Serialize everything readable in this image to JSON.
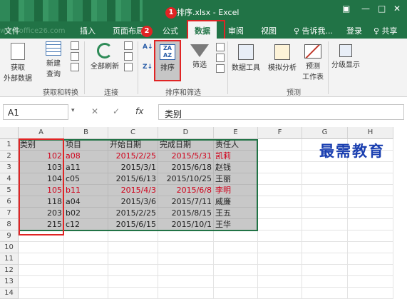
{
  "window": {
    "title": "排序.xlsx - Excel",
    "restore_icon": "ribbon-display-icon",
    "minimize": "—",
    "maximize": "□",
    "close": "✕"
  },
  "watermark_url": "www.office26.com",
  "tabs": [
    {
      "label": "文件"
    },
    {
      "label": "插入"
    },
    {
      "label": "页面布局"
    },
    {
      "label": "公式"
    },
    {
      "label": "数据",
      "active": true
    },
    {
      "label": "审阅"
    },
    {
      "label": "视图"
    },
    {
      "label": "♀ 告诉我..."
    },
    {
      "label": "登录"
    },
    {
      "label": "♀ 共享"
    }
  ],
  "badges": {
    "one": "1",
    "two": "2"
  },
  "ribbon": {
    "get_data": "获取\n外部数据",
    "new_query": "新建\n查询",
    "refresh_all": "全部刷新",
    "sort": "排序",
    "filter": "筛选",
    "data_tools": "数据工具",
    "what_if": "模拟分析",
    "forecast_sheet": "预测\n工作表",
    "outline": "分级显示",
    "groups": {
      "get_transform": "获取和转换",
      "connections": "连接",
      "sort_filter": "排序和筛选",
      "forecast": "预测"
    }
  },
  "formula_bar": {
    "name_box": "A1",
    "cancel": "✕",
    "enter": "✓",
    "fx": "fx",
    "content": "类别"
  },
  "columns": [
    "A",
    "B",
    "C",
    "D",
    "E",
    "F",
    "G",
    "H"
  ],
  "rows": [
    "1",
    "2",
    "3",
    "4",
    "5",
    "6",
    "7",
    "8",
    "9",
    "10",
    "11",
    "12",
    "13",
    "14"
  ],
  "table": {
    "headers": [
      "类别",
      "项目",
      "开始日期",
      "完成日期",
      "责任人"
    ],
    "data": [
      {
        "a": "102",
        "b": "a08",
        "c": "2015/2/25",
        "d": "2015/5/31",
        "e": "凯莉",
        "red": true
      },
      {
        "a": "103",
        "b": "a11",
        "c": "2015/3/1",
        "d": "2015/6/18",
        "e": "赵钱",
        "red": false
      },
      {
        "a": "104",
        "b": "c05",
        "c": "2015/6/13",
        "d": "2015/10/25",
        "e": "王丽",
        "red": false
      },
      {
        "a": "105",
        "b": "b11",
        "c": "2015/4/3",
        "d": "2015/6/8",
        "e": "李明",
        "red": true
      },
      {
        "a": "118",
        "b": "a04",
        "c": "2015/3/6",
        "d": "2015/7/11",
        "e": "威廉",
        "red": false
      },
      {
        "a": "203",
        "b": "b02",
        "c": "2015/2/25",
        "d": "2015/8/15",
        "e": "王五",
        "red": false
      },
      {
        "a": "215",
        "b": "c12",
        "c": "2015/6/15",
        "d": "2015/10/1",
        "e": "王华",
        "red": false
      }
    ]
  },
  "brand_watermark": "最需教育"
}
